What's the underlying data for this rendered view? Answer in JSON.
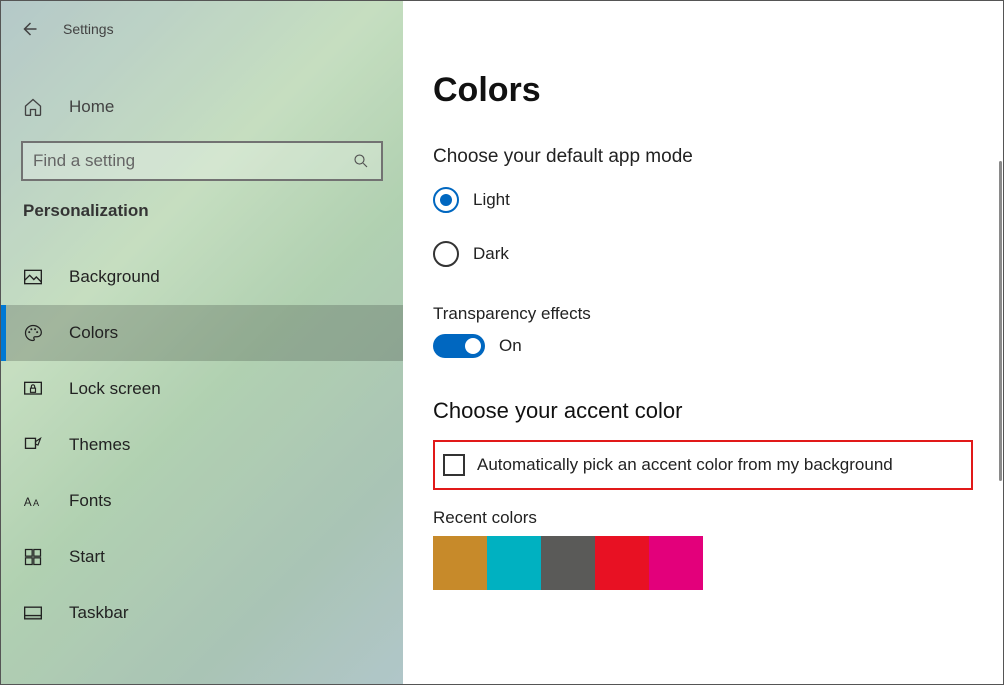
{
  "app_title": "Settings",
  "home_label": "Home",
  "search_placeholder": "Find a setting",
  "section_header": "Personalization",
  "nav": [
    {
      "label": "Background"
    },
    {
      "label": "Colors"
    },
    {
      "label": "Lock screen"
    },
    {
      "label": "Themes"
    },
    {
      "label": "Fonts"
    },
    {
      "label": "Start"
    },
    {
      "label": "Taskbar"
    }
  ],
  "page": {
    "title": "Colors",
    "app_mode_label": "Choose your default app mode",
    "option_light": "Light",
    "option_dark": "Dark",
    "transparency_label": "Transparency effects",
    "transparency_value": "On",
    "accent_title": "Choose your accent color",
    "auto_accent_label": "Automatically pick an accent color from my background",
    "recent_colors_label": "Recent colors",
    "recent_colors": [
      "#c78a2a",
      "#00b1c1",
      "#5a5a58",
      "#e81123",
      "#e3007b"
    ]
  }
}
